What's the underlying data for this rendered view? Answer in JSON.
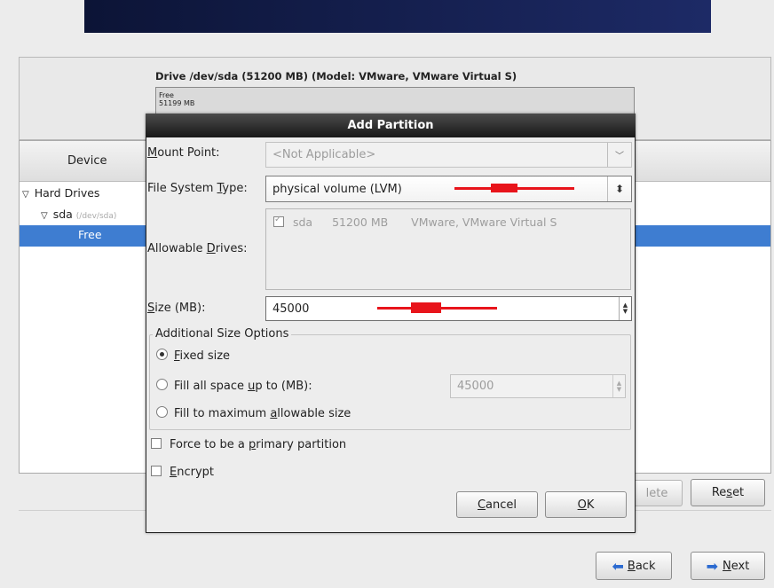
{
  "drive": {
    "title": "Drive /dev/sda (51200 MB) (Model: VMware, VMware Virtual S)",
    "bar_line1": "Free",
    "bar_line2": "51199 MB"
  },
  "tree": {
    "column_device": "Device",
    "hard_drives": "Hard Drives",
    "sda": "sda",
    "sda_path": "(/dev/sda)",
    "free": "Free"
  },
  "buttons": {
    "delete": "lete",
    "reset_pre": "Re",
    "reset_key": "s",
    "reset_post": "et",
    "back_key": "B",
    "back_rest": "ack",
    "next_key": "N",
    "next_rest": "ext"
  },
  "dialog": {
    "title": "Add Partition",
    "mount_label_key": "M",
    "mount_label_rest": "ount Point:",
    "mount_value": "<Not Applicable>",
    "fstype_label_pre": "File System ",
    "fstype_label_key": "T",
    "fstype_label_post": "ype:",
    "fstype_value": "physical volume (LVM)",
    "drives_label_pre": "Allowable ",
    "drives_label_key": "D",
    "drives_label_post": "rives:",
    "drive_name": "sda",
    "drive_size": "51200 MB",
    "drive_model": "VMware, VMware Virtual S",
    "size_label_key": "S",
    "size_label_rest": "ize (MB):",
    "size_value": "45000",
    "size_options_label": "Additional Size Options",
    "opt_fixed_key": "F",
    "opt_fixed_rest": "ixed size",
    "opt_fill_pre": "Fill all space ",
    "opt_fill_key": "u",
    "opt_fill_post": "p to (MB):",
    "fill_value": "45000",
    "opt_max_pre": "Fill to maximum ",
    "opt_max_key": "a",
    "opt_max_post": "llowable size",
    "force_pre": "Force to be a ",
    "force_key": "p",
    "force_post": "rimary partition",
    "encrypt_key": "E",
    "encrypt_rest": "ncrypt",
    "cancel_key": "C",
    "cancel_rest": "ancel",
    "ok_key": "O",
    "ok_rest": "K"
  },
  "colors": {
    "selection": "#3e7dd1",
    "annotation_arrow": "#e8141b",
    "banner": "#1d2a66"
  }
}
